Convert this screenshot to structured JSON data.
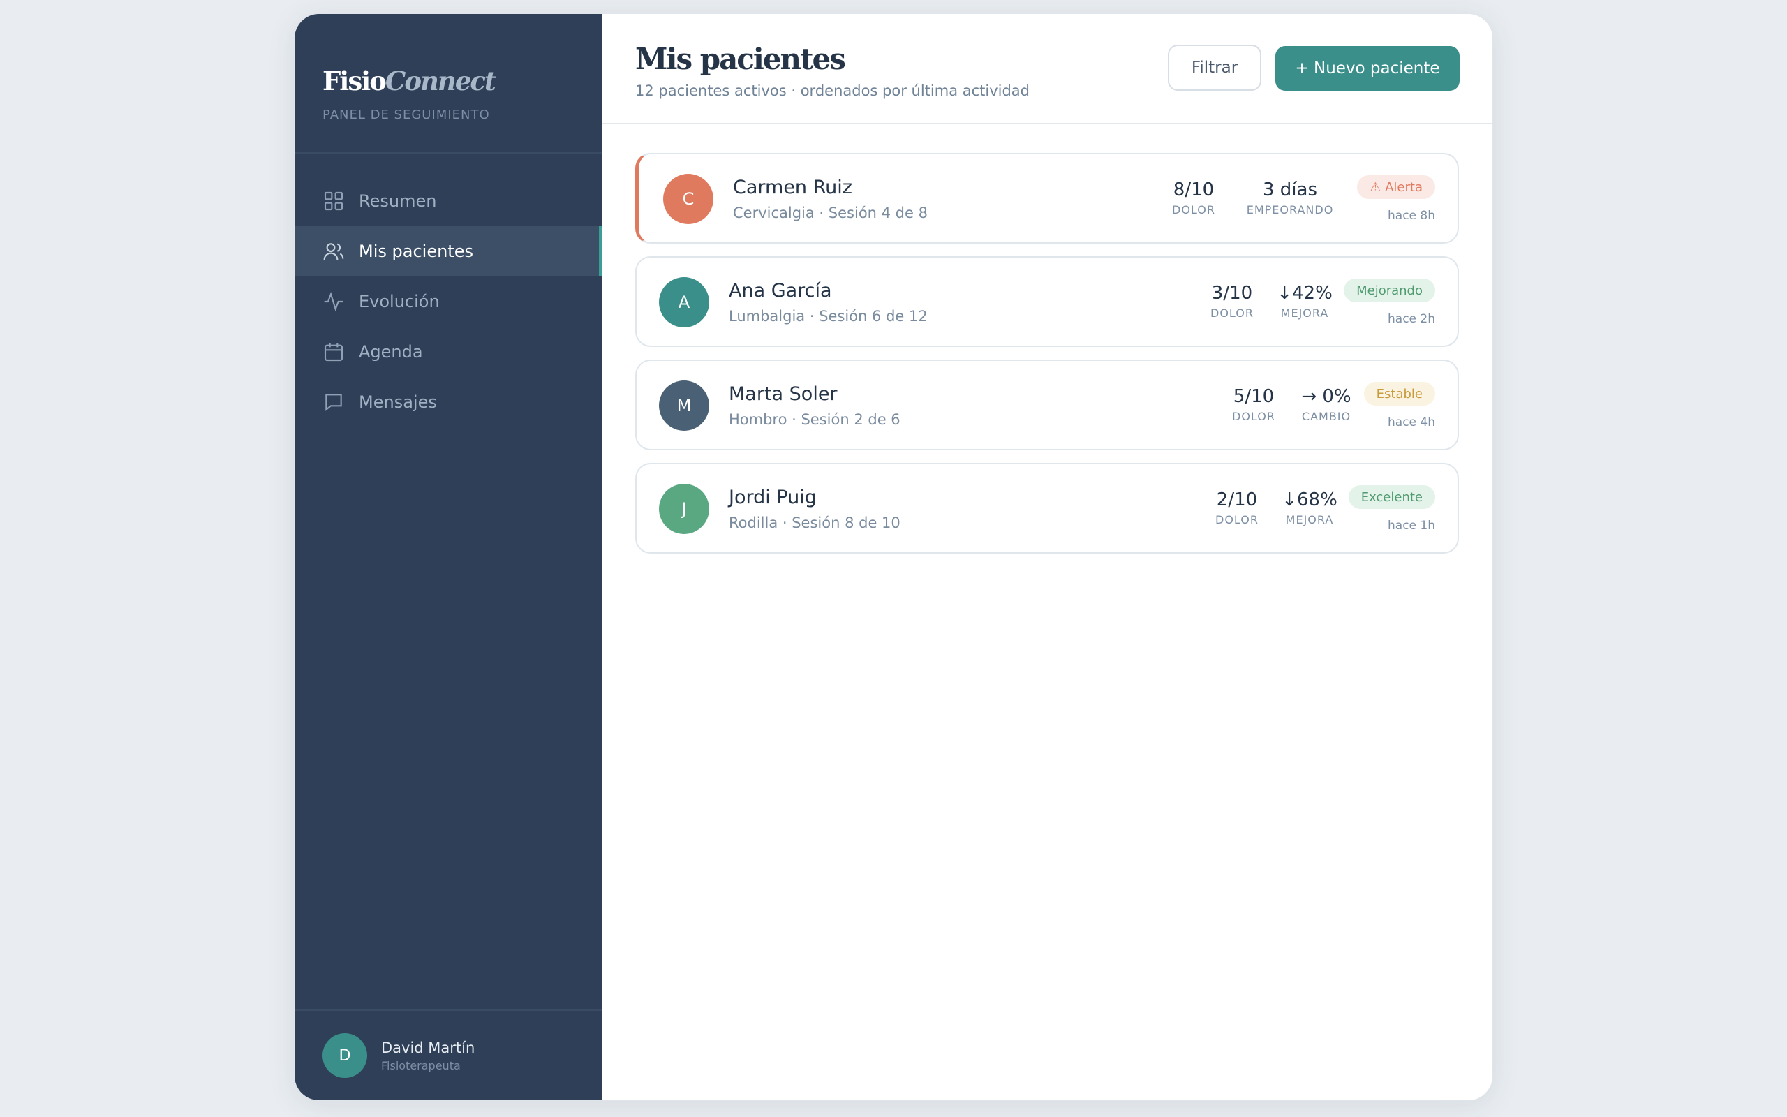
{
  "brand": {
    "logo_a": "Fisio",
    "logo_b": "Connect",
    "tagline": "PANEL DE SEGUIMIENTO"
  },
  "nav": [
    {
      "label": "Resumen",
      "icon": "grid-icon"
    },
    {
      "label": "Mis pacientes",
      "icon": "users-icon",
      "active": true
    },
    {
      "label": "Evolución",
      "icon": "activity-icon"
    },
    {
      "label": "Agenda",
      "icon": "calendar-icon"
    },
    {
      "label": "Mensajes",
      "icon": "message-icon"
    }
  ],
  "user": {
    "initial": "D",
    "name": "David Martín",
    "role": "Fisioterapeuta"
  },
  "header": {
    "title": "Mis pacientes",
    "subtitle": "12 pacientes activos · ordenados por última actividad",
    "filter_label": "Filtrar",
    "new_label": "+ Nuevo paciente"
  },
  "patients": [
    {
      "initial": "C",
      "name": "Carmen Ruiz",
      "sub": "Cervicalgia · Sesión 4 de 8",
      "stat1_value": "8/10",
      "stat1_label": "DOLOR",
      "stat2_value": "3 días",
      "stat2_label": "EMPEORANDO",
      "badge": "⚠ Alerta",
      "time": "hace 8h"
    },
    {
      "initial": "A",
      "name": "Ana García",
      "sub": "Lumbalgia · Sesión 6 de 12",
      "stat1_value": "3/10",
      "stat1_label": "DOLOR",
      "stat2_value": "↓42%",
      "stat2_label": "MEJORA",
      "badge": "Mejorando",
      "time": "hace 2h"
    },
    {
      "initial": "M",
      "name": "Marta Soler",
      "sub": "Hombro · Sesión 2 de 6",
      "stat1_value": "5/10",
      "stat1_label": "DOLOR",
      "stat2_value": "→ 0%",
      "stat2_label": "CAMBIO",
      "badge": "Estable",
      "time": "hace 4h"
    },
    {
      "initial": "J",
      "name": "Jordi Puig",
      "sub": "Rodilla · Sesión 8 de 10",
      "stat1_value": "2/10",
      "stat1_label": "DOLOR",
      "stat2_value": "↓68%",
      "stat2_label": "MEJORA",
      "badge": "Excelente",
      "time": "hace 1h"
    }
  ],
  "colors": {
    "sidebar": "#2e3f57",
    "accent": "#3a8f8a",
    "alert": "#e07a5f",
    "avatar_c": "#e07a5f",
    "avatar_a": "#3a8f8a",
    "avatar_m": "#4a6075",
    "avatar_j": "#5aa882",
    "badge_alert_bg": "#fbe9e5",
    "badge_alert_fg": "#e07a5f",
    "badge_good_bg": "#e4f3ea",
    "badge_good_fg": "#4f9a6e",
    "badge_stable_bg": "#fbf3e1",
    "badge_stable_fg": "#c79a3a"
  }
}
